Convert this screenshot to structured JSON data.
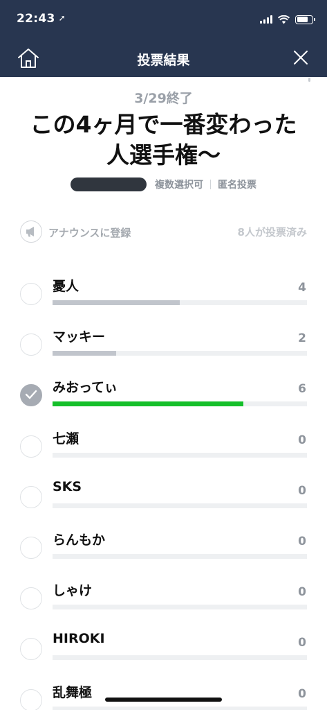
{
  "status_bar": {
    "time": "22:43"
  },
  "nav": {
    "title": "投票結果"
  },
  "poll": {
    "closed_date": "3/29終了",
    "title_line1": "この4ヶ月で一番変わった",
    "title_line2": "人選手権〜",
    "tag_multiple": "複数選択可",
    "tag_anonymous": "匿名投票"
  },
  "announce": {
    "label": "アナウンスに登録"
  },
  "voted_count": "8人が投票済み",
  "options": [
    {
      "label": "憂人",
      "count": "4",
      "fraction": 0.5,
      "checked": false,
      "winner": false
    },
    {
      "label": "マッキー",
      "count": "2",
      "fraction": 0.25,
      "checked": false,
      "winner": false
    },
    {
      "label": "みおってぃ",
      "count": "6",
      "fraction": 0.75,
      "checked": true,
      "winner": true
    },
    {
      "label": "七瀬",
      "count": "0",
      "fraction": 0,
      "checked": false,
      "winner": false
    },
    {
      "label": "SKS",
      "count": "0",
      "fraction": 0,
      "checked": false,
      "winner": false
    },
    {
      "label": "らんもか",
      "count": "0",
      "fraction": 0,
      "checked": false,
      "winner": false
    },
    {
      "label": "しゃけ",
      "count": "0",
      "fraction": 0,
      "checked": false,
      "winner": false
    },
    {
      "label": "HIROKI",
      "count": "0",
      "fraction": 0,
      "checked": false,
      "winner": false
    },
    {
      "label": "乱舞極",
      "count": "0",
      "fraction": 0,
      "checked": false,
      "winner": false
    }
  ],
  "colors": {
    "header_bg": "#283650",
    "winner_bar": "#15bf2a",
    "bar": "#c1c5cc",
    "track": "#eef0f2"
  }
}
